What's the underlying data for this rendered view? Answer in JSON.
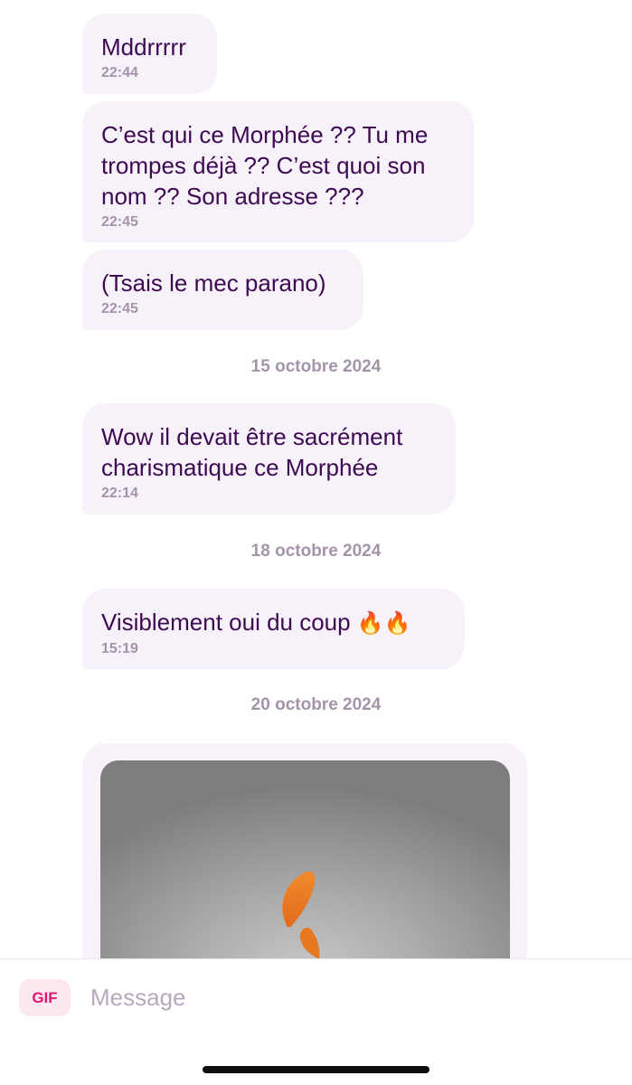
{
  "messages": [
    {
      "text": "Mddrrrrr",
      "time": "22:44"
    },
    {
      "text": "C’est qui ce Morphée ?? Tu me\ntrompes déjà ?? C’est quoi son\nnom ?? Son adresse ???",
      "time": "22:45"
    },
    {
      "text": "(Tsais le mec parano)",
      "time": "22:45"
    },
    {
      "text": "Wow il devait être sacrément\ncharismatique ce Morphée",
      "time": "22:14"
    },
    {
      "text": "Visiblement oui du coup",
      "emoji": "🔥🔥",
      "time": "15:19"
    }
  ],
  "date_separators": [
    "15 octobre 2024",
    "18 octobre 2024",
    "20 octobre 2024"
  ],
  "media_message": {
    "icon": "flame-gif-image"
  },
  "composer": {
    "gif_label": "GIF",
    "placeholder": "Message",
    "value": ""
  },
  "colors": {
    "bubble_bg": "#f7f1fa",
    "message_text": "#3d0a52",
    "meta_text": "#a394a9",
    "gif_accent": "#e3166f"
  }
}
